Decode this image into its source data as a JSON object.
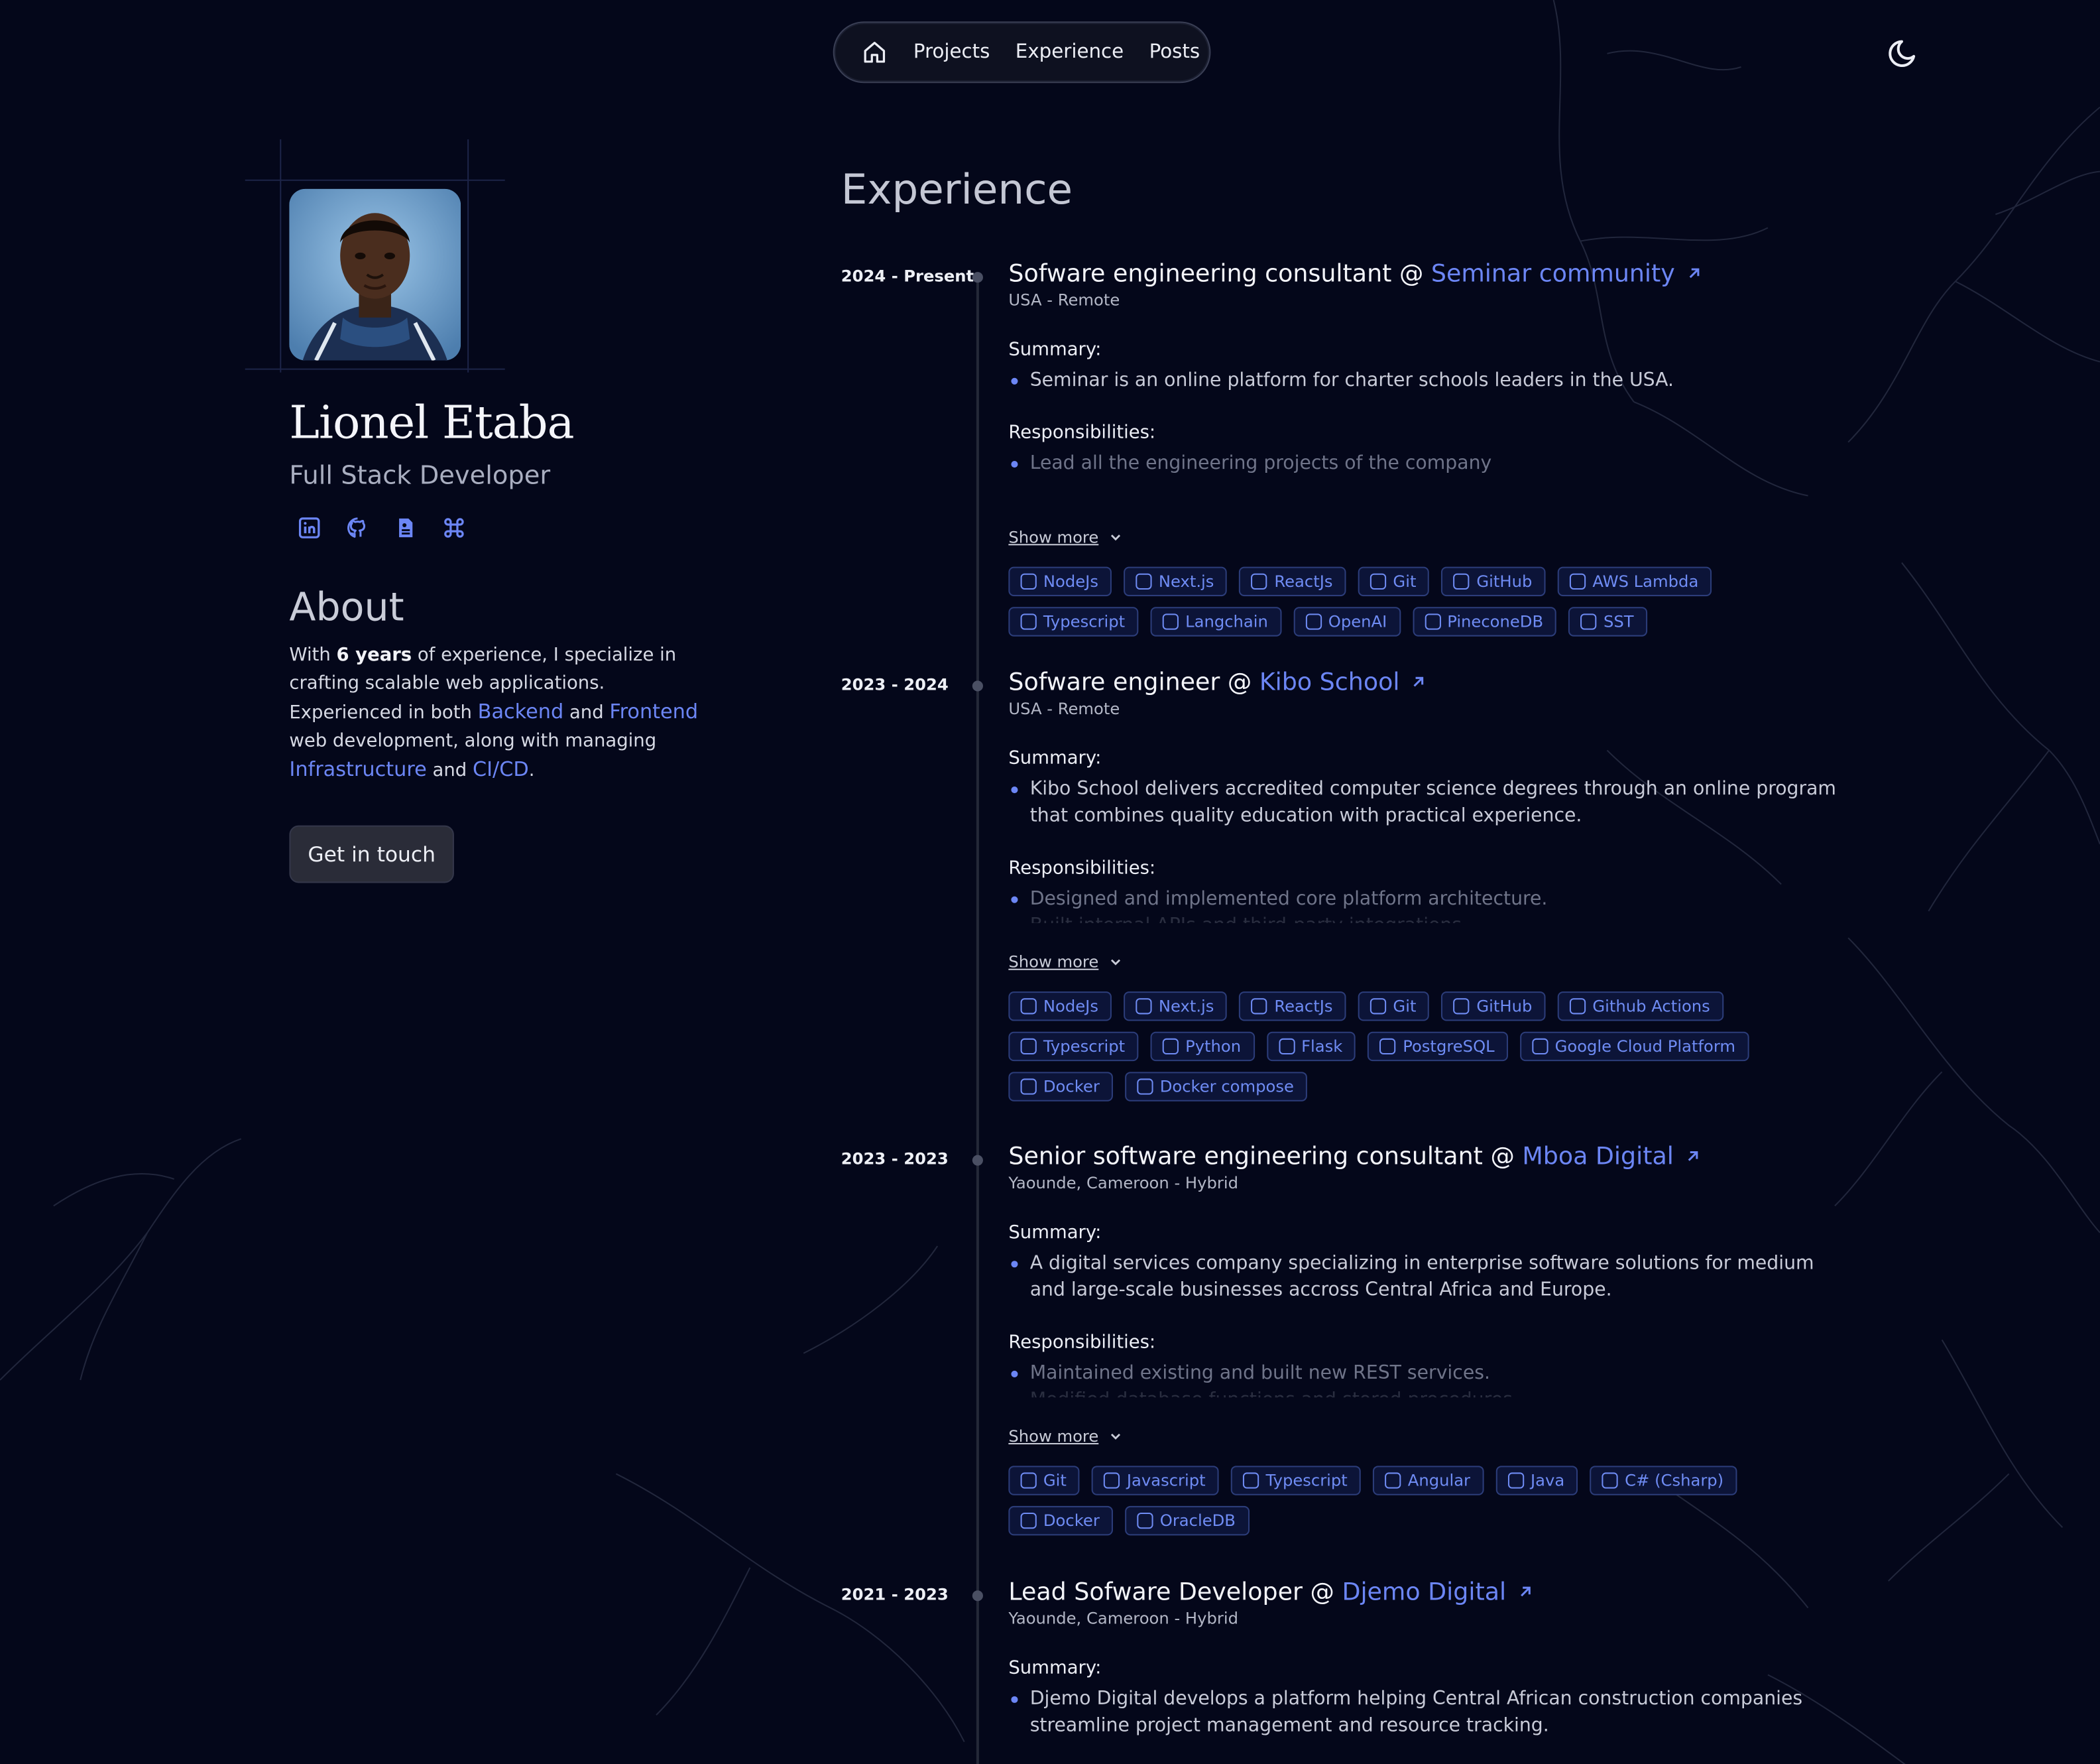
{
  "nav": {
    "links": [
      "Projects",
      "Experience",
      "Posts"
    ]
  },
  "profile": {
    "name": "Lionel Etaba",
    "role": "Full Stack Developer"
  },
  "about": {
    "title": "About",
    "line1_a": "With ",
    "line1_b": "6 years",
    "line1_c": " of experience, I specialize in crafting scalable web applications.",
    "line2_a": "Experienced in both ",
    "backend": "Backend",
    "and1": " and ",
    "frontend": "Frontend",
    "line2_b": " web development, along with managing ",
    "infra": "Infrastructure",
    "and2": " and ",
    "cicd": "CI/CD",
    "dot": "."
  },
  "cta": "Get in touch",
  "experience": {
    "title": "Experience",
    "summary_label": "Summary:",
    "resp_label": "Responsibilities:",
    "show_more": "Show more",
    "entries": [
      {
        "date": "2024 - Present",
        "title": "Sofware engineering consultant @ ",
        "company": "Seminar community",
        "location": "USA - Remote",
        "summary": [
          "Seminar is an online platform for charter schools leaders in the USA."
        ],
        "responsibilities": [
          "Lead all the engineering projects of the company"
        ],
        "tags": [
          "NodeJs",
          "Next.js",
          "ReactJs",
          "Git",
          "GitHub",
          "AWS Lambda",
          "Typescript",
          "Langchain",
          "OpenAI",
          "PineconeDB",
          "SST"
        ]
      },
      {
        "date": "2023 - 2024",
        "title": "Sofware engineer @ ",
        "company": "Kibo School",
        "location": "USA - Remote",
        "summary": [
          "Kibo School delivers accredited computer science degrees through an online program that combines quality education with practical experience."
        ],
        "responsibilities": [
          "Designed and implemented core platform architecture.",
          "Built internal APIs and third-party integrations."
        ],
        "tags": [
          "NodeJs",
          "Next.js",
          "ReactJs",
          "Git",
          "GitHub",
          "Github Actions",
          "Typescript",
          "Python",
          "Flask",
          "PostgreSQL",
          "Google Cloud Platform",
          "Docker",
          "Docker compose"
        ]
      },
      {
        "date": "2023 - 2023",
        "title": "Senior software engineering consultant @ ",
        "company": "Mboa Digital",
        "location": "Yaounde, Cameroon - Hybrid",
        "summary": [
          "A digital services company specializing in enterprise software solutions for medium and large-scale businesses accross Central Africa and Europe."
        ],
        "responsibilities": [
          "Maintained existing and built new REST services.",
          "Modified database functions and stored procedures."
        ],
        "tags": [
          "Git",
          "Javascript",
          "Typescript",
          "Angular",
          "Java",
          "C# (Csharp)",
          "Docker",
          "OracleDB"
        ]
      },
      {
        "date": "2021 - 2023",
        "title": "Lead Sofware Developer @ ",
        "company": "Djemo Digital",
        "location": "Yaounde, Cameroon - Hybrid",
        "summary": [
          "Djemo Digital develops a platform helping Central African construction companies streamline project management and resource tracking."
        ],
        "responsibilities": [],
        "tags": []
      }
    ]
  },
  "icons": {
    "home": "home-icon",
    "theme": "moon-icon",
    "socials": [
      "linkedin-icon",
      "github-icon",
      "resume-icon",
      "command-icon"
    ]
  },
  "colors": {
    "accent": "#6c86f5",
    "background": "#04071a"
  }
}
